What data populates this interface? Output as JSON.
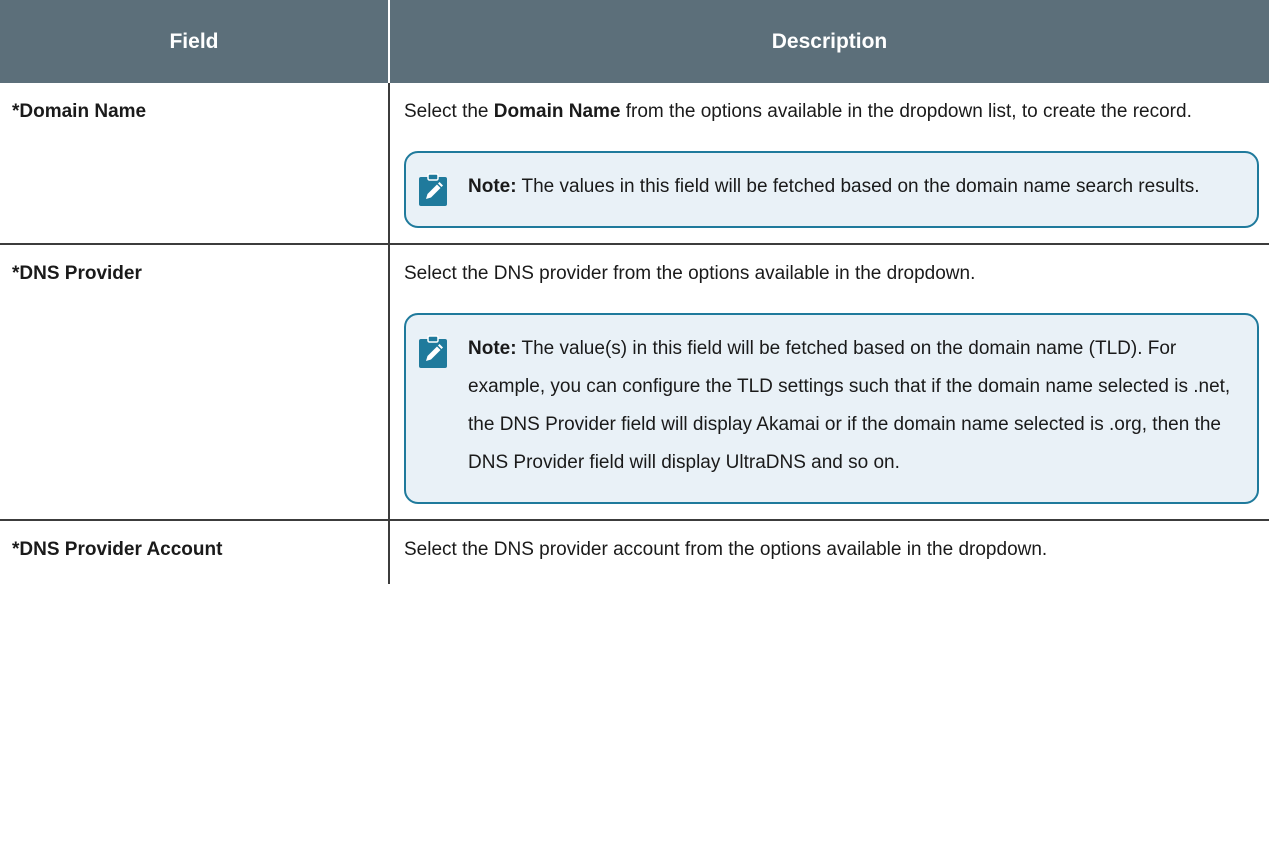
{
  "table": {
    "headers": {
      "field": "Field",
      "description": "Description"
    },
    "rows": [
      {
        "field": "*Domain Name",
        "description_pre": "Select the ",
        "description_bold": "Domain Name",
        "description_post": " from the options available in the dropdown list, to create the record.",
        "note": {
          "label": "Note:",
          "text": " The values in this field will be fetched based on the domain name search results.",
          "icon": "note-pencil-icon"
        }
      },
      {
        "field": "*DNS Provider",
        "description": "Select the DNS provider from the options available in the dropdown.",
        "note": {
          "label": "Note:",
          "text": " The value(s) in this field will be fetched based on the domain name (TLD). For example, you can configure the TLD settings such that if the domain name selected is .net, the DNS Provider field will display Akamai or if the domain name selected is .org, then the DNS Provider field will display UltraDNS and so on.",
          "icon": "note-pencil-icon"
        }
      },
      {
        "field": "*DNS Provider Account",
        "description": "Select the DNS provider account from the options available in the dropdown."
      }
    ]
  },
  "colors": {
    "header_bg": "#5c6f7a",
    "note_border": "#1f7a9c",
    "note_bg": "#e9f1f7",
    "icon_bg": "#1f7a9c"
  }
}
